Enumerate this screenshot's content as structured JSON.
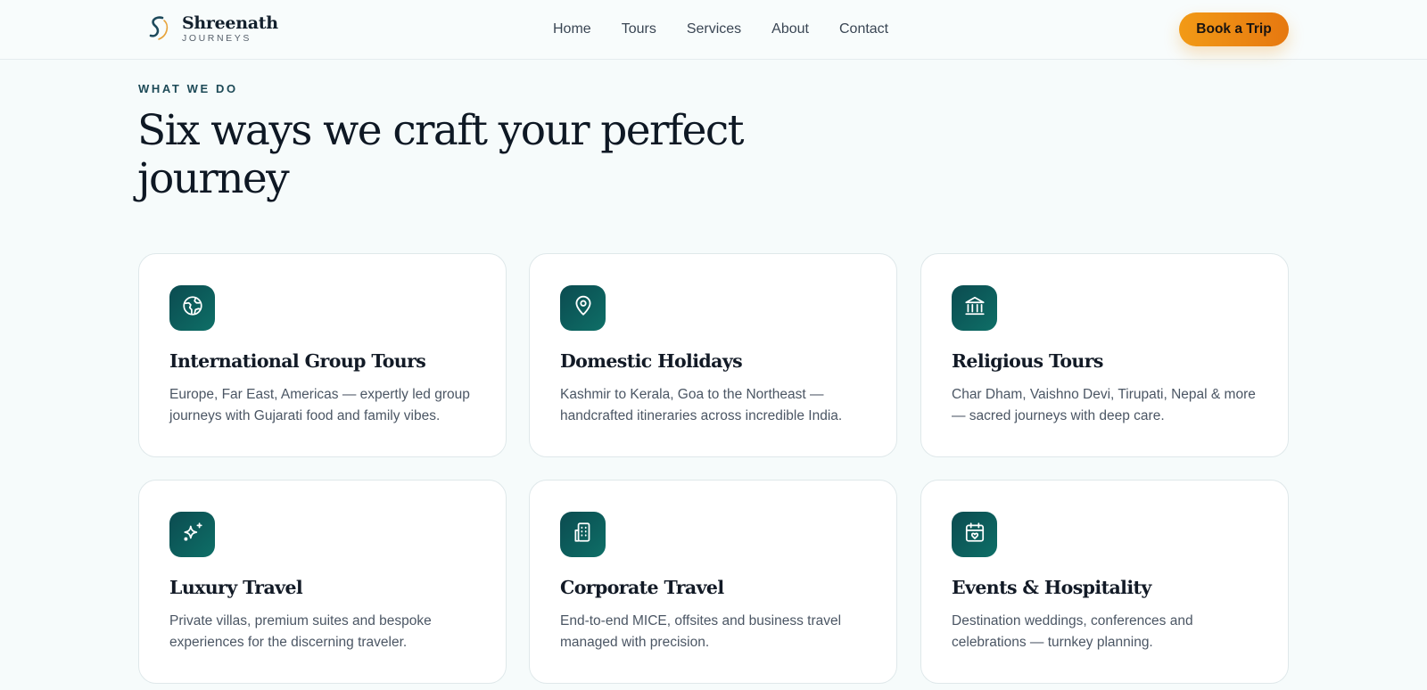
{
  "brand": {
    "name": "Shreenath",
    "tagline": "JOURNEYS"
  },
  "nav": {
    "items": [
      "Home",
      "Tours",
      "Services",
      "About",
      "Contact"
    ],
    "cta_label": "Book a Trip"
  },
  "section": {
    "eyebrow": "WHAT WE DO",
    "headline": "Six ways we craft your perfect journey"
  },
  "services": [
    {
      "title": "International Group Tours",
      "description": "Europe, Far East, Americas — expertly led group journeys with Gujarati food and family vibes.",
      "icon": "globe-icon"
    },
    {
      "title": "Domestic Holidays",
      "description": "Kashmir to Kerala, Goa to the Northeast — handcrafted itineraries across incredible India.",
      "icon": "map-pin-icon"
    },
    {
      "title": "Religious Tours",
      "description": "Char Dham, Vaishno Devi, Tirupati, Nepal & more — sacred journeys with deep care.",
      "icon": "temple-icon"
    },
    {
      "title": "Luxury Travel",
      "description": "Private villas, premium suites and bespoke experiences for the discerning traveler.",
      "icon": "sparkles-icon"
    },
    {
      "title": "Corporate Travel",
      "description": "End-to-end MICE, offsites and business travel managed with precision.",
      "icon": "building-icon"
    },
    {
      "title": "Events & Hospitality",
      "description": "Destination weddings, conferences and celebrations — turnkey planning.",
      "icon": "calendar-heart-icon"
    }
  ],
  "colors": {
    "accent": "#f0900f",
    "icon_bg": "#0d5c5c",
    "background": "#f6fbfb"
  }
}
